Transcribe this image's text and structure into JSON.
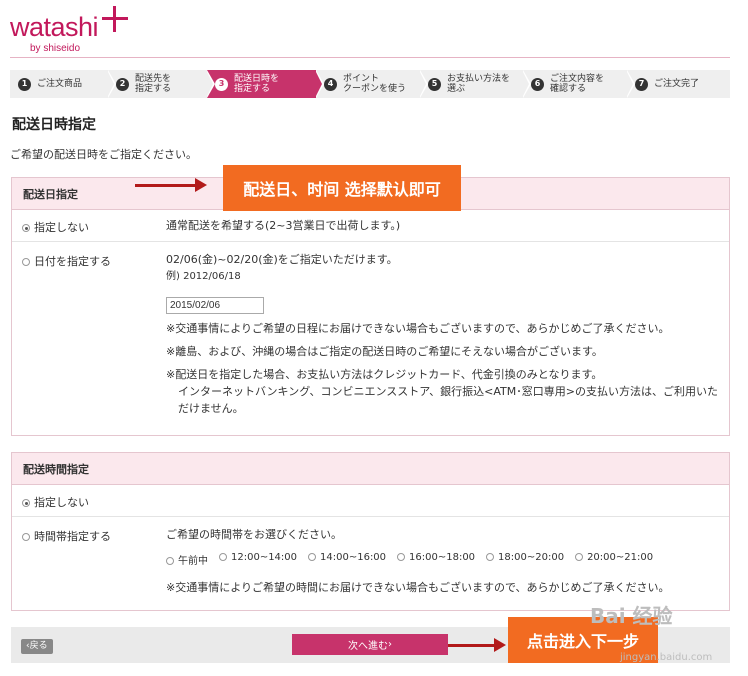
{
  "logo": {
    "word": "watashi",
    "sub": "by shiseido",
    "brand_color": "#c2185b"
  },
  "steps": [
    {
      "num": "1",
      "label": "ご注文商品"
    },
    {
      "num": "2",
      "label": "配送先を\n指定する"
    },
    {
      "num": "3",
      "label": "配送日時を\n指定する",
      "active": true
    },
    {
      "num": "4",
      "label": "ポイント\nクーポンを使う"
    },
    {
      "num": "5",
      "label": "お支払い方法を\n選ぶ"
    },
    {
      "num": "6",
      "label": "ご注文内容を\n確認する"
    },
    {
      "num": "7",
      "label": "ご注文完了"
    }
  ],
  "page_title": "配送日時指定",
  "intro": "ご希望の配送日時をご指定ください。",
  "delivery_date": {
    "heading": "配送日指定",
    "opt_none_label": "指定しない",
    "opt_none_text": "通常配送を希望する(2~3営業日で出荷します。)",
    "opt_date_label": "日付を指定する",
    "range_text": "02/06(金)~02/20(金)をご指定いただけます。",
    "example": "例) 2012/06/18",
    "date_value": "2015/02/06",
    "note1": "※交通事情によりご希望の日程にお届けできない場合もございますので、あらかじめご了承ください。",
    "note2": "※離島、および、沖縄の場合はご指定の配送日時のご希望にそえない場合がございます。",
    "note3a": "※配送日を指定した場合、お支払い方法はクレジットカード、代金引換のみとなります。",
    "note3b": "インターネットバンキング、コンビニエンスストア、銀行振込<ATM･窓口専用>の支払い方法は、ご利用いた",
    "note3c": "だけません。"
  },
  "delivery_time": {
    "heading": "配送時間指定",
    "opt_none_label": "指定しない",
    "opt_time_label": "時間帯指定する",
    "prompt": "ご希望の時間帯をお選びください。",
    "slots": [
      "午前中",
      "12:00~14:00",
      "14:00~16:00",
      "16:00~18:00",
      "18:00~20:00",
      "20:00~21:00"
    ],
    "note": "※交通事情によりご希望の時間にお届けできない場合もございますので、あらかじめご了承ください。"
  },
  "buttons": {
    "back": "戻る",
    "next": "次へ進む"
  },
  "annotations": {
    "top": "配送日、时间  选择默认即可",
    "bottom": "点击进入下一步",
    "color": "#f26b21"
  },
  "watermark": {
    "main": "Bai 经验",
    "sub": "jingyan.baidu.com"
  }
}
